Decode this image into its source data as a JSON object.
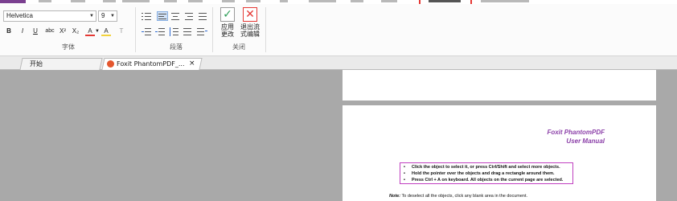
{
  "ribbon": {
    "font_group": {
      "font_name": "Helvetica",
      "font_size": "9",
      "label": "字体",
      "buttons": [
        "B",
        "I",
        "U",
        "abc",
        "X²",
        "X₂",
        "A",
        "A",
        "T"
      ]
    },
    "paragraph_group": {
      "label": "段落"
    },
    "close_group": {
      "label": "关闭",
      "apply_label": "应用\n更改",
      "exit_label": "退出流\n式编辑"
    }
  },
  "tabs": [
    {
      "label": "开始"
    },
    {
      "label": "Foxit PhantomPDF_...",
      "close": "×"
    }
  ],
  "document": {
    "title_line1": "Foxit  PhantomPDF",
    "title_line2": "User Manual",
    "bullets": [
      "Click the object to select it, or press Ctrl/Shift and select more objects.",
      "Hold the pointer over the objects and drag a rectangle around them.",
      "Press Ctrl + A on keyboard. All objects on the current page are selected."
    ],
    "note_label": "Note:",
    "note_text": " To deselect all the objects, click any blank area in the document."
  },
  "colors": {
    "accent_purple": "#7a3f8f",
    "title_purple": "#8b3fa8",
    "highlight_red": "#e53935",
    "apply_green": "#2e9e58",
    "exit_red": "#e53935"
  }
}
